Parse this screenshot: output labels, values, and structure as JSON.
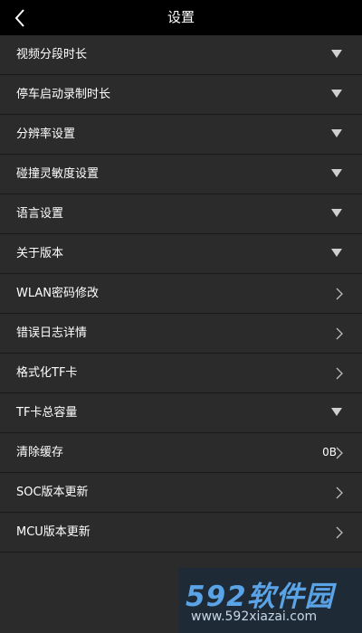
{
  "header": {
    "title": "设置",
    "back_icon": "chevron-left-icon"
  },
  "items": [
    {
      "label": "视频分段时长",
      "value": "",
      "control": "dropdown"
    },
    {
      "label": "停车启动录制时长",
      "value": "",
      "control": "dropdown"
    },
    {
      "label": "分辨率设置",
      "value": "",
      "control": "dropdown"
    },
    {
      "label": "碰撞灵敏度设置",
      "value": "",
      "control": "dropdown"
    },
    {
      "label": "语言设置",
      "value": "",
      "control": "dropdown"
    },
    {
      "label": "关于版本",
      "value": "",
      "control": "dropdown"
    },
    {
      "label": "WLAN密码修改",
      "value": "",
      "control": "arrow"
    },
    {
      "label": "错误日志详情",
      "value": "",
      "control": "arrow"
    },
    {
      "label": "格式化TF卡",
      "value": "",
      "control": "arrow"
    },
    {
      "label": "TF卡总容量",
      "value": "",
      "control": "dropdown"
    },
    {
      "label": "清除缓存",
      "value": "0B",
      "control": "arrow"
    },
    {
      "label": "SOC版本更新",
      "value": "",
      "control": "arrow"
    },
    {
      "label": "MCU版本更新",
      "value": "",
      "control": "arrow"
    }
  ],
  "watermark": {
    "brand": "592软件园",
    "url": "www.592xiazai.com"
  },
  "colors": {
    "background": "#2b2b2b",
    "topbar": "#000000",
    "divider": "#1a1a1a",
    "watermark_blue": "#5aa3e6"
  }
}
